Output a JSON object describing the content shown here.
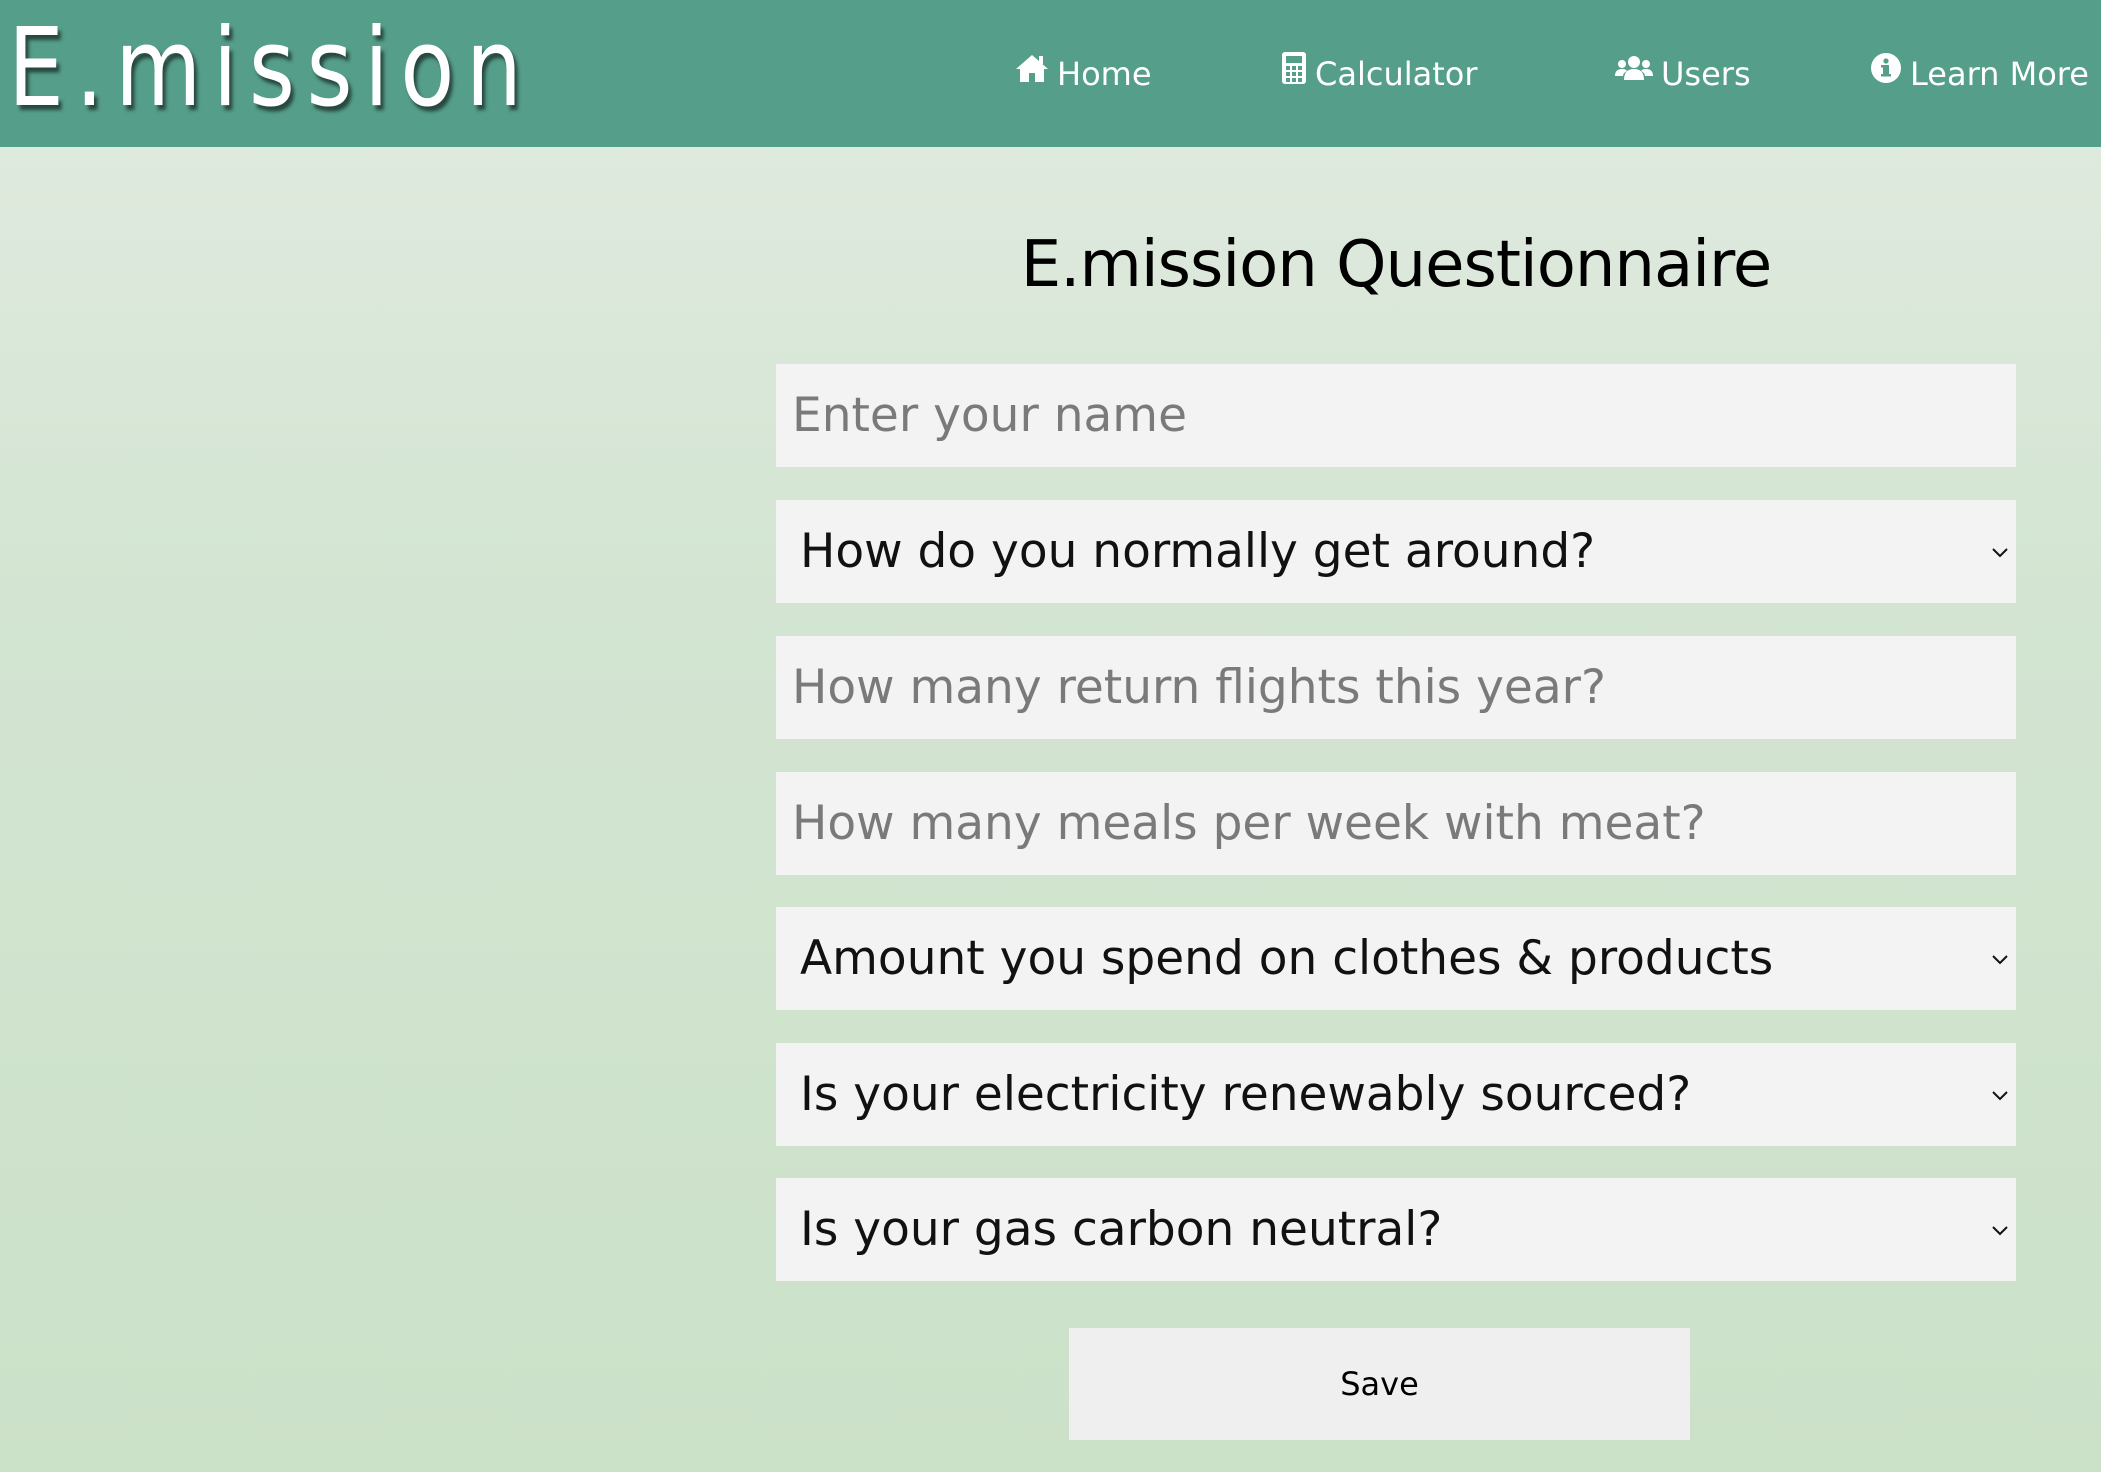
{
  "header": {
    "logo_text": "E.mission",
    "nav": [
      {
        "label": "Home",
        "icon": "home-icon"
      },
      {
        "label": "Calculator",
        "icon": "calculator-icon"
      },
      {
        "label": "Users",
        "icon": "users-icon"
      },
      {
        "label": "Learn More",
        "icon": "info-icon"
      }
    ],
    "background_color": "#559e8a"
  },
  "main": {
    "title": "E.mission Questionnaire",
    "name_input": {
      "placeholder": "Enter your name",
      "value": ""
    },
    "transport_select": {
      "selected": "How do you normally get around?"
    },
    "flights_input": {
      "placeholder": "How many return flights this year?",
      "value": ""
    },
    "meals_input": {
      "placeholder": "How many meals per week with meat?",
      "value": ""
    },
    "spending_select": {
      "selected": "Amount you spend on clothes & products"
    },
    "electricity_select": {
      "selected": "Is your electricity renewably sourced?"
    },
    "gas_select": {
      "selected": "Is your gas carbon neutral?"
    },
    "save_label": "Save"
  }
}
